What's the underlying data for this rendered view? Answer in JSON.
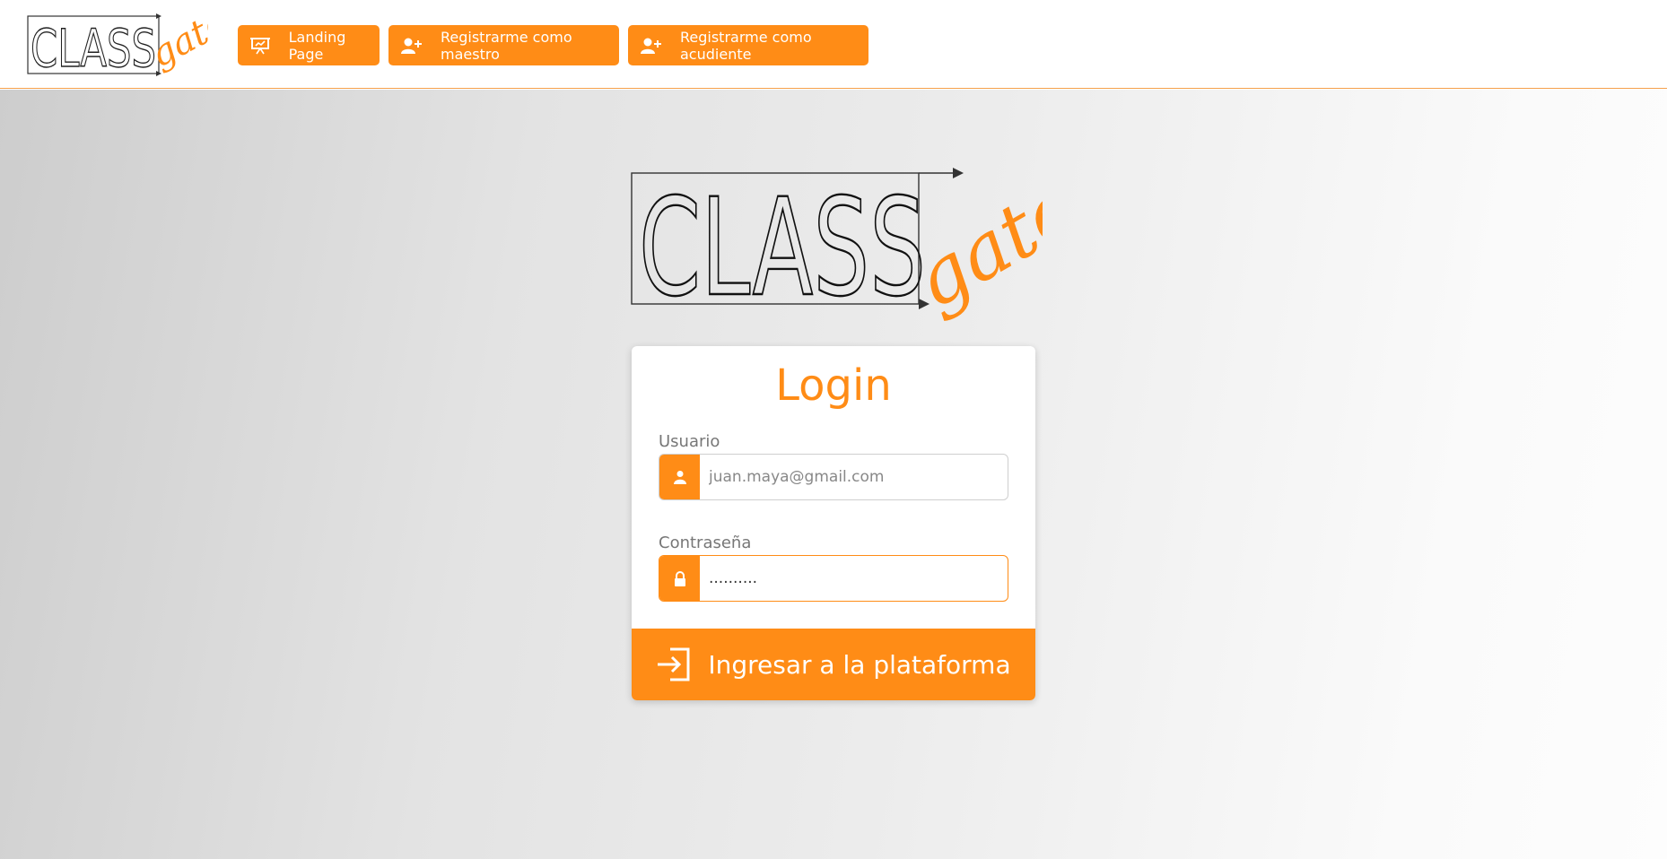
{
  "brand": {
    "name_main": "CLASS",
    "name_script": "gate",
    "accent_color": "#ff8c16"
  },
  "nav": {
    "landing": {
      "label": "Landing Page",
      "icon": "presentation-board-icon"
    },
    "register_teacher": {
      "label": "Registrarme como maestro",
      "icon": "user-plus-icon"
    },
    "register_guardian": {
      "label": "Registrarme como acudiente",
      "icon": "user-plus-icon"
    }
  },
  "login": {
    "title": "Login",
    "username": {
      "label": "Usuario",
      "placeholder": "juan.maya@gmail.com",
      "value": "",
      "icon": "user-icon"
    },
    "password": {
      "label": "Contraseña",
      "value": "..........",
      "icon": "lock-icon"
    },
    "submit": {
      "label": "Ingresar a la plataforma",
      "icon": "sign-in-icon"
    }
  }
}
